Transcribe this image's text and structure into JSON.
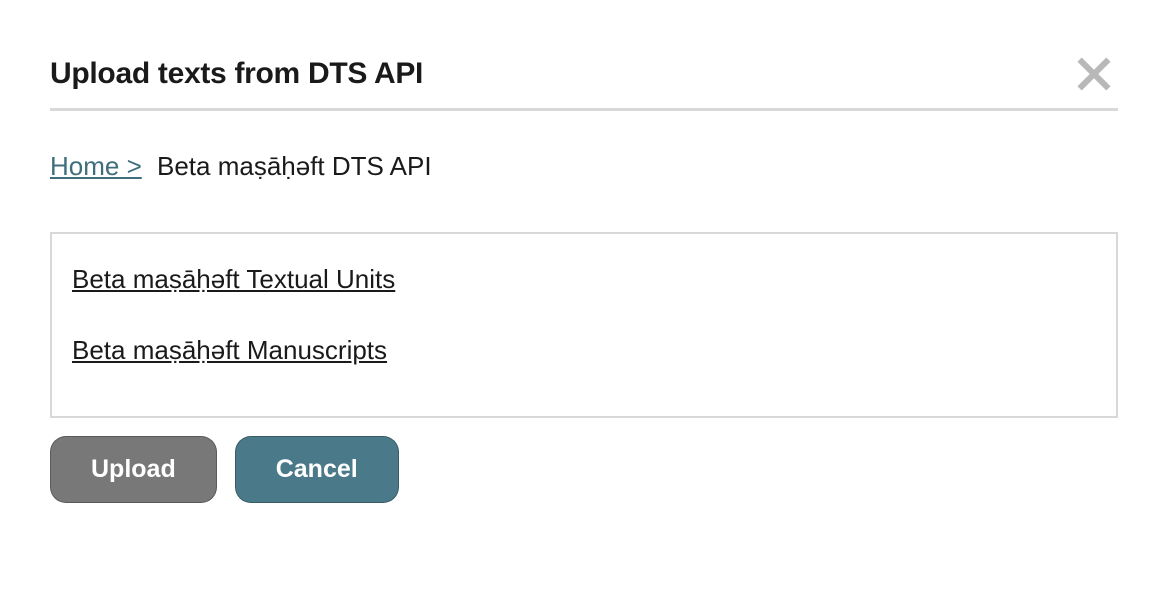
{
  "dialog": {
    "title": "Upload texts from DTS API"
  },
  "breadcrumb": {
    "home_label": "Home >",
    "current": "Beta maṣāḥəft DTS API"
  },
  "listing": {
    "items": [
      {
        "label": "Beta maṣāḥəft Textual Units"
      },
      {
        "label": "Beta maṣāḥəft Manuscripts"
      }
    ]
  },
  "buttons": {
    "upload": "Upload",
    "cancel": "Cancel"
  }
}
